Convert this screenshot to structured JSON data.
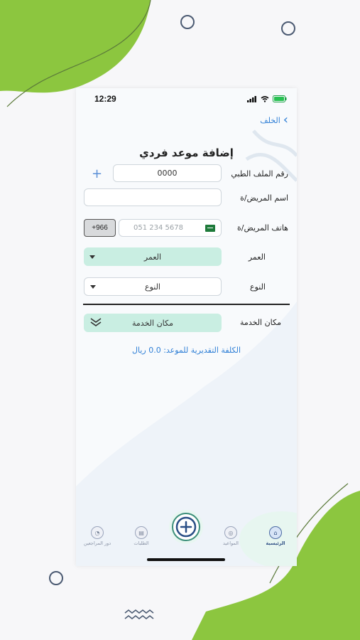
{
  "status_bar": {
    "time": "12:29"
  },
  "header": {
    "back_label": "الخلف",
    "title": "إضافة موعد فردي"
  },
  "form": {
    "medical_file": {
      "label": "رقم الملف الطبي",
      "value": "0000",
      "add_icon": "plus-icon"
    },
    "patient_name": {
      "label": "اسم المريض/ة",
      "value": ""
    },
    "patient_phone": {
      "label": "هاتف المريض/ة",
      "placeholder": "051 234 5678",
      "country_code": "+966",
      "flag": "saudi-flag-icon"
    },
    "age": {
      "label": "العمر",
      "selected": "العمر"
    },
    "gender": {
      "label": "النوع",
      "selected": "النوع"
    },
    "service_place": {
      "label": "مكان الخدمة",
      "selected": "مكان الخدمة"
    },
    "estimated_cost": "الكلفة التقديرية للموعد: 0.0 ريال"
  },
  "bottom_nav": {
    "items": [
      {
        "label": "الرئيسية",
        "icon": "home-icon",
        "active": true
      },
      {
        "label": "المواعيد",
        "icon": "appointments-icon",
        "active": false
      },
      {
        "label": "الطلبات",
        "icon": "requests-icon",
        "active": false
      },
      {
        "label": "دور المراجعين",
        "icon": "queue-icon",
        "active": false
      }
    ],
    "center_icon": "add-icon"
  },
  "colors": {
    "accent": "#2f7fd6",
    "green_blob": "#8cc63f",
    "select_green": "#c9eee2"
  }
}
